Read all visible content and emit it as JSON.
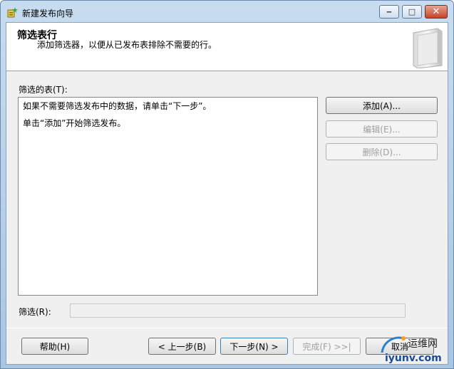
{
  "window": {
    "title": "新建发布向导"
  },
  "header": {
    "title": "筛选表行",
    "subtitle": "添加筛选器，以便从已发布表排除不需要的行。"
  },
  "filtered_tables": {
    "label": "筛选的表(T):",
    "lines": [
      "如果不需要筛选发布中的数据，请单击“下一步”。",
      "单击“添加”开始筛选发布。"
    ]
  },
  "side_buttons": {
    "add": "添加(A)...",
    "edit": "编辑(E)...",
    "delete": "删除(D)..."
  },
  "filter": {
    "label": "筛选(R):",
    "value": ""
  },
  "footer": {
    "help": "帮助(H)",
    "back": "< 上一步(B)",
    "next": "下一步(N) >",
    "finish": "完成(F) >>|",
    "cancel": "取消"
  },
  "watermark": {
    "line1": "运维网",
    "line2": "iyunv.com"
  },
  "icons": {
    "app": "wizard-icon",
    "header": "glass-panel-graphic"
  },
  "colors": {
    "title_bar": "#b9d1ea",
    "dialog_bg": "#f0f0f0",
    "close_button": "#c2452b",
    "disabled_text": "#a0a0a0"
  }
}
